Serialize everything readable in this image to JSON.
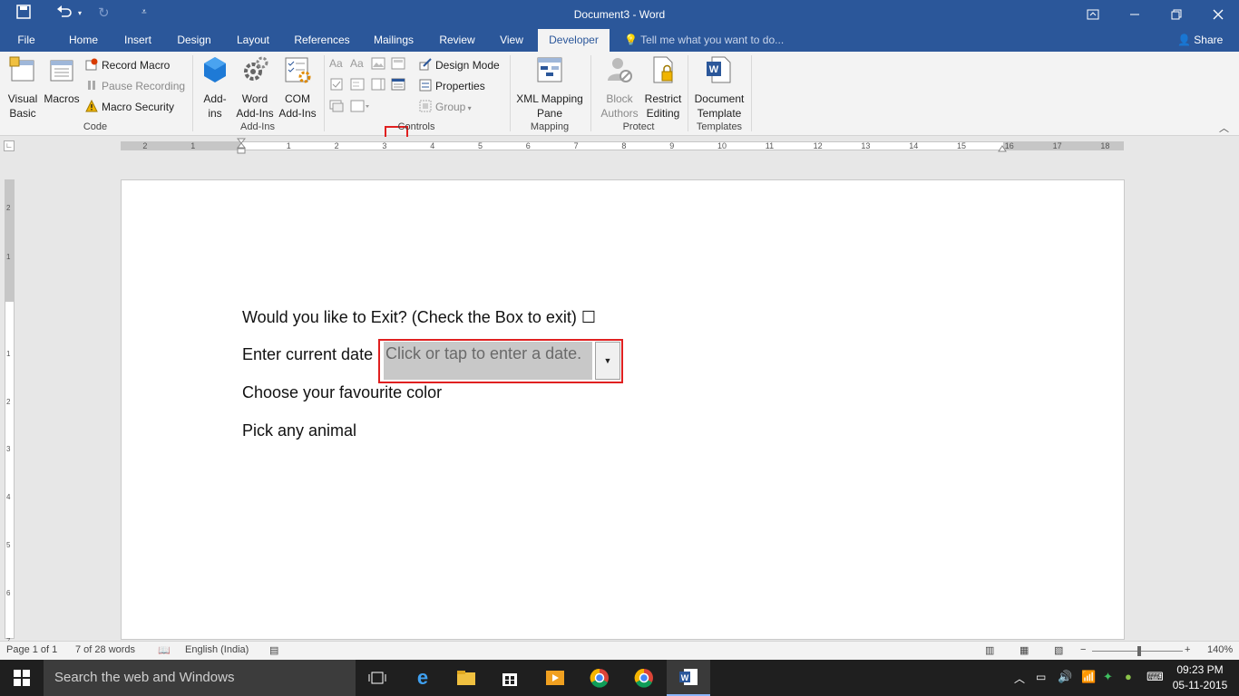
{
  "window": {
    "title": "Document3 - Word"
  },
  "tabs": [
    "File",
    "Home",
    "Insert",
    "Design",
    "Layout",
    "References",
    "Mailings",
    "Review",
    "View",
    "Developer"
  ],
  "active_tab": "Developer",
  "tell_me": {
    "placeholder": "Tell me what you want to do..."
  },
  "share_label": "Share",
  "ribbon": {
    "code": {
      "label": "Code",
      "visual_basic": "Visual\nBasic",
      "macros": "Macros",
      "record_macro": "Record Macro",
      "pause_recording": "Pause Recording",
      "macro_security": "Macro Security"
    },
    "addins": {
      "label": "Add-Ins",
      "addins": "Add-\nins",
      "word_addins": "Word\nAdd-Ins",
      "com_addins": "COM\nAdd-Ins"
    },
    "controls": {
      "label": "Controls",
      "design_mode": "Design Mode",
      "properties": "Properties",
      "group": "Group"
    },
    "mapping": {
      "label": "Mapping",
      "xml_mapping_pane": "XML Mapping\nPane"
    },
    "protect": {
      "label": "Protect",
      "block_authors": "Block\nAuthors",
      "restrict_editing": "Restrict\nEditing"
    },
    "templates": {
      "label": "Templates",
      "document_template": "Document\nTemplate"
    }
  },
  "ruler_numbers": [
    "2",
    "1",
    "1",
    "2",
    "3",
    "4",
    "5",
    "6",
    "7",
    "8",
    "9",
    "10",
    "11",
    "12",
    "13",
    "14",
    "15",
    "16",
    "17",
    "18"
  ],
  "vruler_numbers": [
    "2",
    "1",
    "1",
    "2",
    "3",
    "4",
    "5",
    "6",
    "7"
  ],
  "document": {
    "line1": "Would you like to Exit? (Check the Box to exit) ☐",
    "line2": "Enter current date",
    "date_placeholder": "Click or tap to enter a date.",
    "line3": "Choose your favourite color",
    "line4": "Pick any animal"
  },
  "status": {
    "page": "Page 1 of 1",
    "words": "7 of 28 words",
    "language": "English (India)",
    "zoom": "140%"
  },
  "taskbar": {
    "search": "Search the web and Windows",
    "time": "09:23 PM",
    "date": "05-11-2015"
  }
}
